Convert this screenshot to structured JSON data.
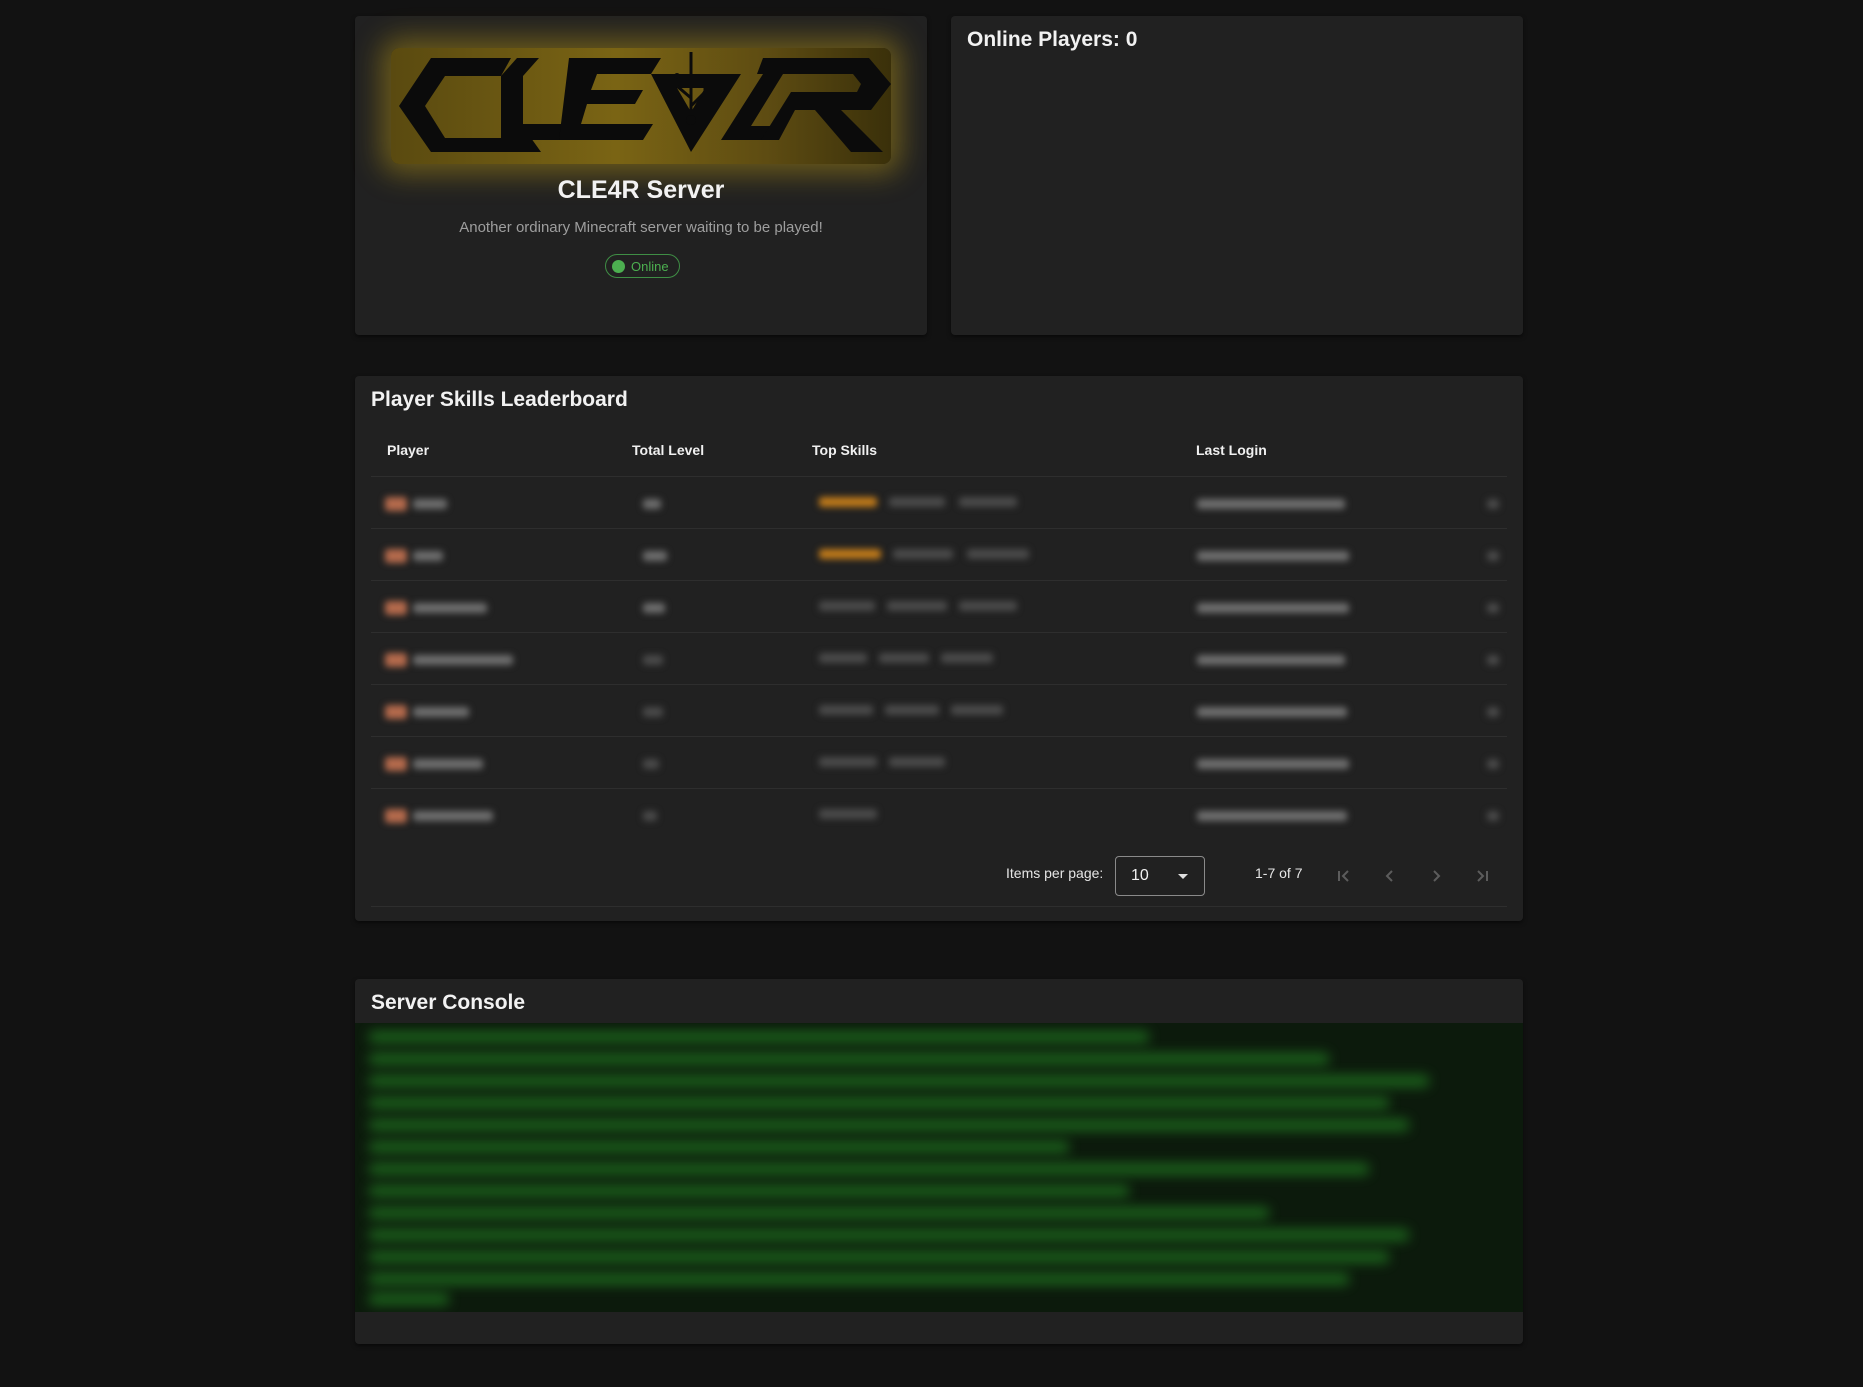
{
  "server": {
    "logo_text": "CLE4R",
    "title": "CLE4R Server",
    "description": "Another ordinary Minecraft server waiting to be played!",
    "status": "Online",
    "status_color": "#4caf50"
  },
  "online": {
    "title": "Online Players: 0"
  },
  "leaderboard": {
    "title": "Player Skills Leaderboard",
    "columns": [
      "Player",
      "Total Level",
      "Top Skills",
      "Last Login"
    ],
    "rows_count": 7,
    "pagination": {
      "items_per_page_label": "Items per page:",
      "items_per_page": "10",
      "range": "1-7 of 7"
    }
  },
  "console": {
    "title": "Server Console"
  },
  "icons": {
    "first_page": "first-page-icon",
    "prev_page": "chevron-left-icon",
    "next_page": "chevron-right-icon",
    "last_page": "last-page-icon",
    "dropdown": "caret-down-icon"
  }
}
